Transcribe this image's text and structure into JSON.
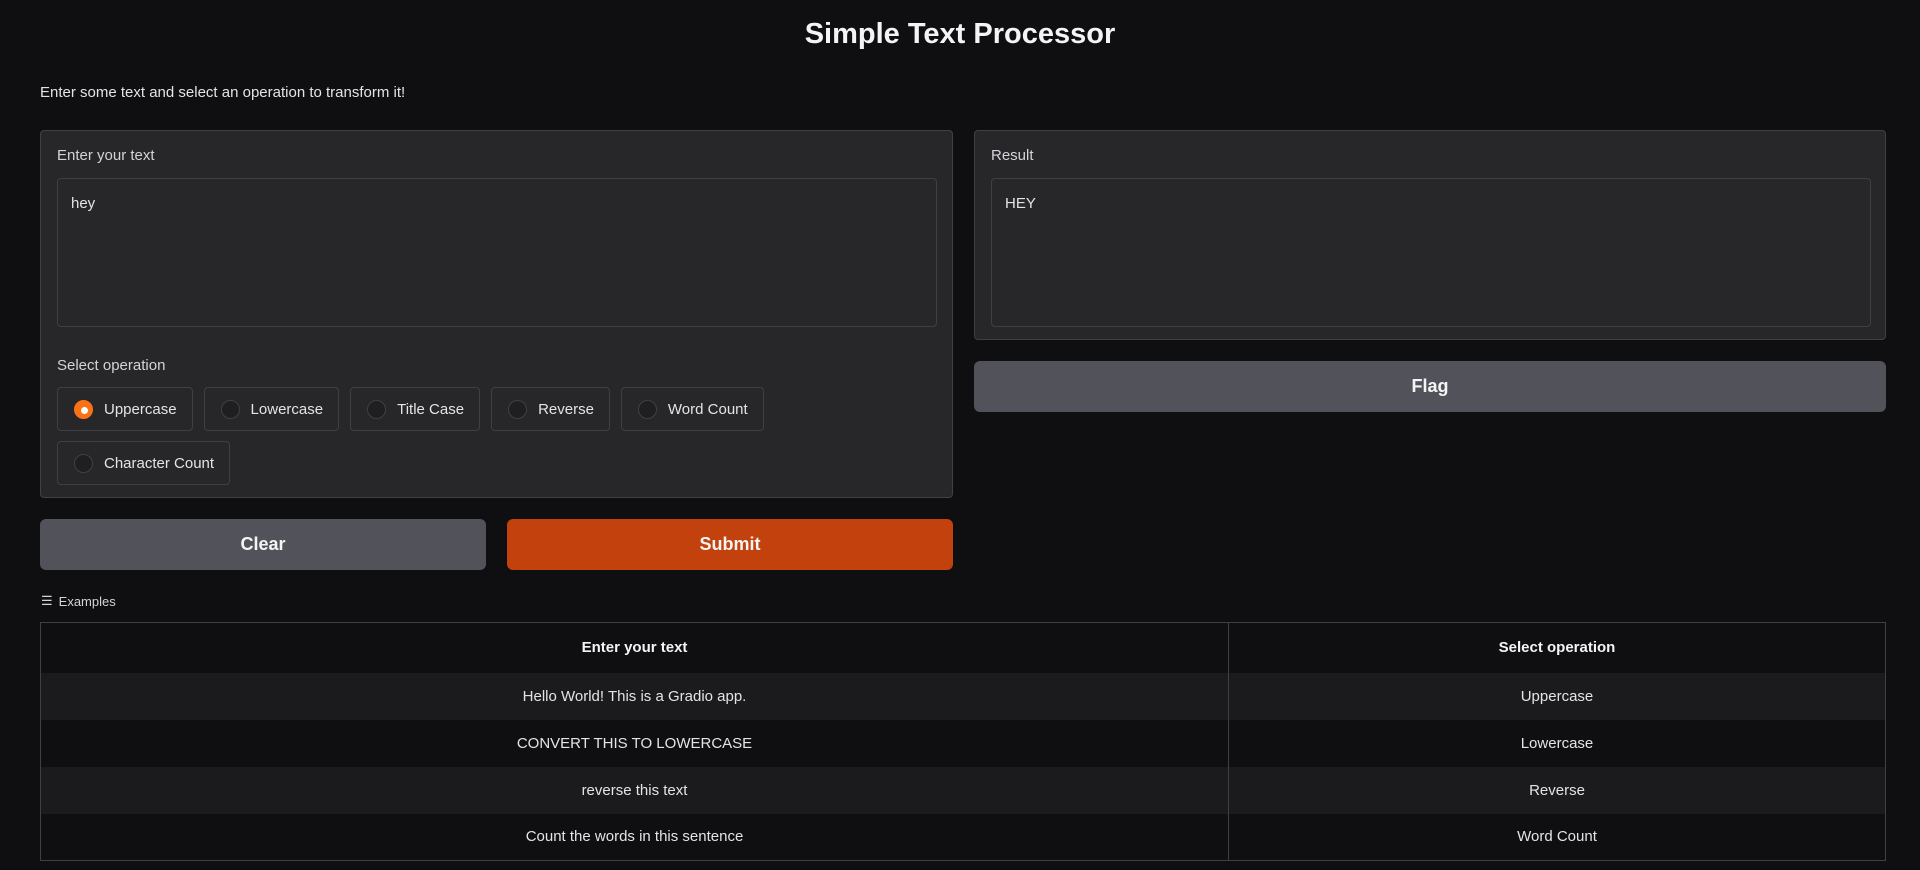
{
  "header": {
    "title": "Simple Text Processor",
    "description": "Enter some text and select an operation to transform it!"
  },
  "input": {
    "label": "Enter your text",
    "value": "hey"
  },
  "operation": {
    "label": "Select operation",
    "selected": "Uppercase",
    "options": [
      "Uppercase",
      "Lowercase",
      "Title Case",
      "Reverse",
      "Word Count",
      "Character Count"
    ]
  },
  "result": {
    "label": "Result",
    "value": "HEY"
  },
  "buttons": {
    "flag": "Flag",
    "clear": "Clear",
    "submit": "Submit"
  },
  "colors": {
    "accent": "#c2410c",
    "radio_selected": "#f97316"
  },
  "examples": {
    "label": "Examples",
    "headers": [
      "Enter your text",
      "Select operation"
    ],
    "rows": [
      [
        "Hello World! This is a Gradio app.",
        "Uppercase"
      ],
      [
        "CONVERT THIS TO LOWERCASE",
        "Lowercase"
      ],
      [
        "reverse this text",
        "Reverse"
      ],
      [
        "Count the words in this sentence",
        "Word Count"
      ]
    ]
  }
}
